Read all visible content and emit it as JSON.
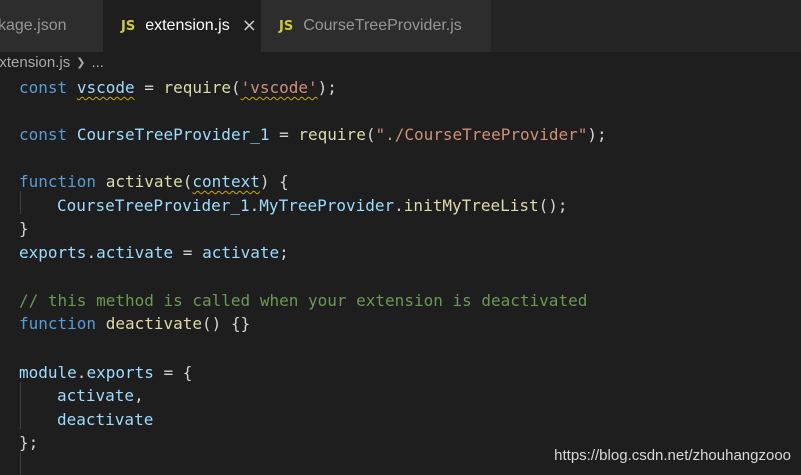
{
  "tabs": [
    {
      "label": "kage.json",
      "active": false
    },
    {
      "label": "extension.js",
      "active": true,
      "icon": "JS"
    },
    {
      "label": "CourseTreeProvider.js",
      "active": false,
      "icon": "JS"
    }
  ],
  "breadcrumb": {
    "file": "extension.js",
    "more": "..."
  },
  "code": {
    "l1": [
      "const",
      "vscode",
      "=",
      "require",
      "(",
      "'vscode'",
      ");"
    ],
    "l3": [
      "const",
      "CourseTreeProvider_1",
      "=",
      "require",
      "(",
      "\"./CourseTreeProvider\"",
      ");"
    ],
    "l5": [
      "function",
      "activate",
      "(",
      "context",
      ")",
      "{"
    ],
    "l6": [
      "CourseTreeProvider_1",
      ".",
      "MyTreeProvider",
      ".",
      "initMyTreeList",
      "();"
    ],
    "l7": "}",
    "l8": [
      "exports",
      ".",
      "activate",
      "=",
      "activate",
      ";"
    ],
    "l10": "// this method is called when your extension is deactivated",
    "l11": [
      "function",
      "deactivate",
      "()",
      "{}"
    ],
    "l13": [
      "module",
      ".",
      "exports",
      "=",
      "{"
    ],
    "l14": [
      "activate",
      ","
    ],
    "l15": "deactivate",
    "l16": "};"
  },
  "watermark": "https://blog.csdn.net/zhouhangzooo",
  "colors": {
    "keyword": "#569cd6",
    "variable": "#9cdcfe",
    "function": "#dcdcaa",
    "string": "#ce9178",
    "comment": "#6a9955",
    "tab_icon": "#cbcb41"
  }
}
